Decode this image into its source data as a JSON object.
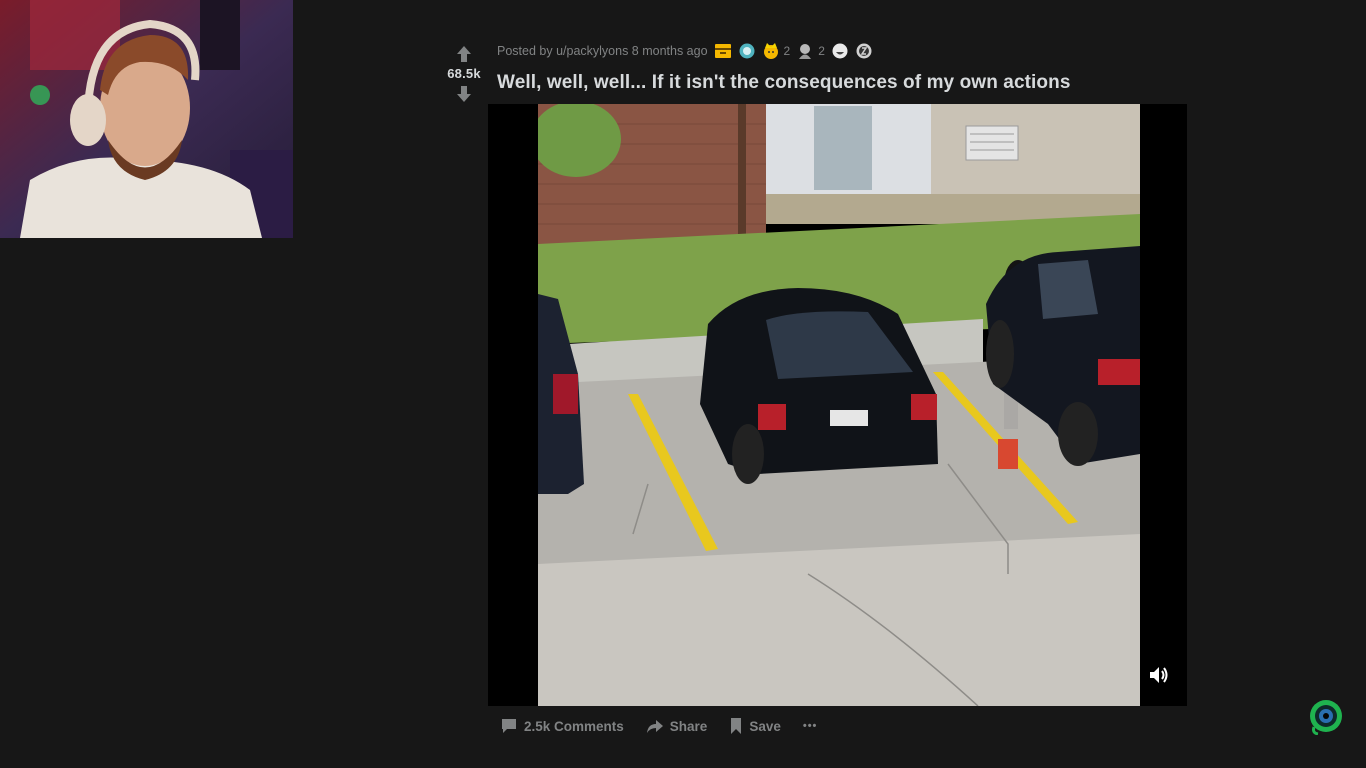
{
  "post": {
    "vote_count": "68.5k",
    "meta_posted_by": "Posted by u/packylyons 8 months ago",
    "awards": [
      {
        "icon": "gold-box-award-icon",
        "count": ""
      },
      {
        "icon": "helpful-award-icon",
        "count": ""
      },
      {
        "icon": "wholesome-award-icon",
        "count": "2"
      },
      {
        "icon": "silver-award-icon",
        "count": "2"
      },
      {
        "icon": "laughing-award-icon",
        "count": ""
      },
      {
        "icon": "coin-award-icon",
        "count": ""
      }
    ],
    "title": "Well, well, well... If it isn't the consequences of my own actions"
  },
  "actions": {
    "comments_label": "2.5k Comments",
    "share_label": "Share",
    "save_label": "Save",
    "more_label": "•••"
  },
  "colors": {
    "background": "#171717",
    "text_primary": "#d7dadc",
    "text_muted": "#818384",
    "lane_yellow": "#e8c81e",
    "badge_green": "#1fb34f"
  }
}
